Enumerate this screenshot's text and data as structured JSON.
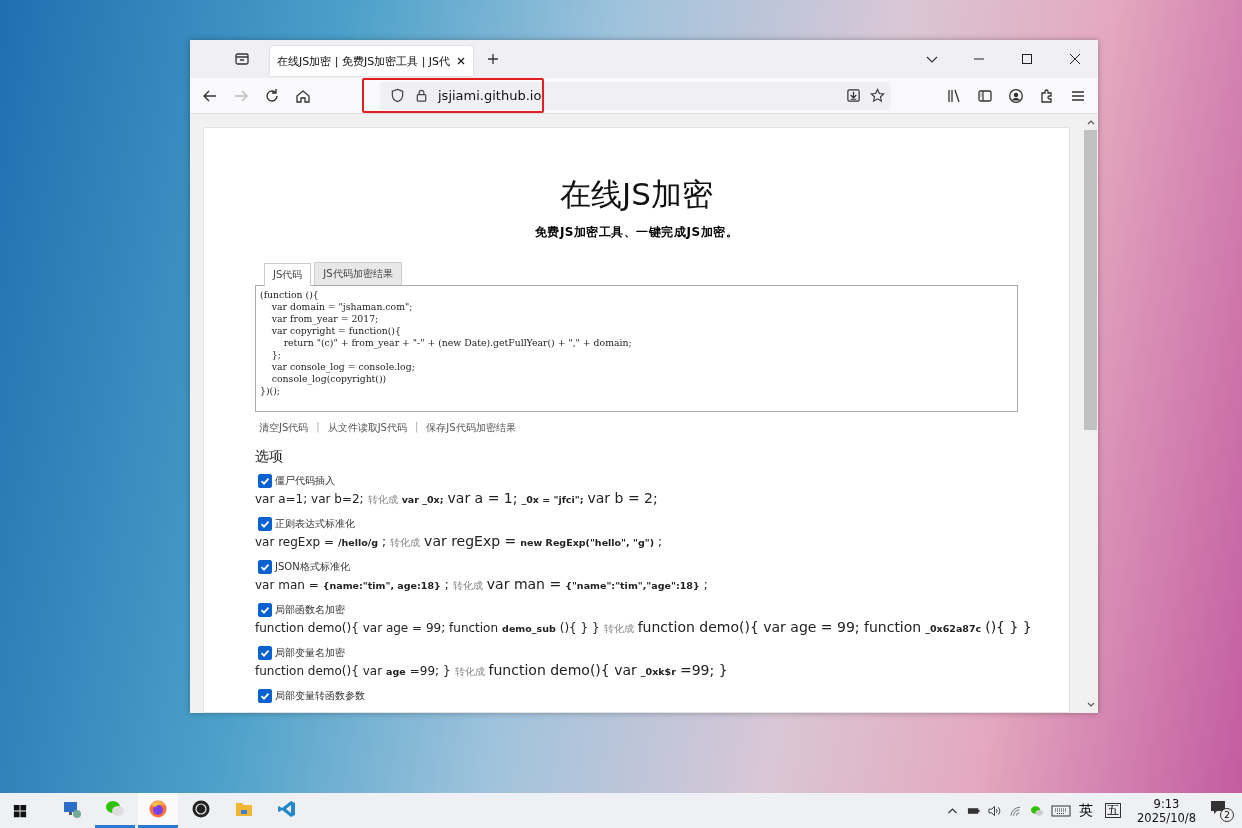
{
  "browser": {
    "tab_title": "在线JS加密 | 免费JS加密工具 | JS代",
    "address": {
      "text": "jsjiami.github.io",
      "highlighted": true
    }
  },
  "page": {
    "title": "在线JS加密",
    "subtitle": "免费JS加密工具、一键完成JS加密。",
    "tabs": [
      {
        "label": "JS代码",
        "selected": true
      },
      {
        "label": "JS代码加密结果",
        "selected": false
      }
    ],
    "code": "(function (){\n    var domain = \"jshaman.com\";\n    var from_year = 2017;\n    var copyright = function(){\n        return \"(c)\" + from_year + \"-\" + (new Date).getFullYear() + \",\" + domain;\n    };\n    var console_log = console.log;\n    console_log(copyright())\n})();",
    "links": [
      {
        "kind": "link",
        "text": "清空JS代码"
      },
      {
        "kind": "separator",
        "text": "|"
      },
      {
        "kind": "link",
        "text": "从文件读取JS代码"
      },
      {
        "kind": "separator",
        "text": "|"
      },
      {
        "kind": "link",
        "text": "保存JS代码加密结果"
      }
    ],
    "options_heading": "选项",
    "options": [
      {
        "label": "僵尸代码插入",
        "checked": true,
        "example": [
          {
            "kind": "plain",
            "text": "var a=1; var b=2;"
          },
          {
            "kind": "arrow",
            "text": "转化成"
          },
          {
            "kind": "bold",
            "text": "var _0x;"
          },
          {
            "kind": "large",
            "text": "var a = 1;"
          },
          {
            "kind": "bold",
            "text": "_0x = \"jfci\";"
          },
          {
            "kind": "large",
            "text": "var b = 2;"
          }
        ]
      },
      {
        "label": "正则表达式标准化",
        "checked": true,
        "example": [
          {
            "kind": "plain",
            "text": "var regExp ="
          },
          {
            "kind": "bold",
            "text": "/hello/g"
          },
          {
            "kind": "plain",
            "text": ";"
          },
          {
            "kind": "arrow",
            "text": "转化成"
          },
          {
            "kind": "large",
            "text": "var regExp ="
          },
          {
            "kind": "bold",
            "text": "new RegExp(\"hello\", \"g\")"
          },
          {
            "kind": "plain",
            "text": ";"
          }
        ]
      },
      {
        "label": "JSON格式标准化",
        "checked": true,
        "example": [
          {
            "kind": "plain",
            "text": "var man ="
          },
          {
            "kind": "bold",
            "text": "{name:\"tim\", age:18}"
          },
          {
            "kind": "plain",
            "text": ";"
          },
          {
            "kind": "arrow",
            "text": "转化成"
          },
          {
            "kind": "large",
            "text": "var man ="
          },
          {
            "kind": "bold",
            "text": "{\"name\":\"tim\",\"age\":18}"
          },
          {
            "kind": "plain",
            "text": ";"
          }
        ]
      },
      {
        "label": "局部函数名加密",
        "checked": true,
        "example": [
          {
            "kind": "plain",
            "text": "function demo(){ var age = 99; function"
          },
          {
            "kind": "bold",
            "text": "demo_sub"
          },
          {
            "kind": "plain",
            "text": "(){ } }"
          },
          {
            "kind": "arrow",
            "text": "转化成"
          },
          {
            "kind": "large",
            "text": "function demo(){ var age = 99; function"
          },
          {
            "kind": "bold",
            "text": "_0x62a87c"
          },
          {
            "kind": "large",
            "text": "(){ } }"
          }
        ]
      },
      {
        "label": "局部变量名加密",
        "checked": true,
        "example": [
          {
            "kind": "plain",
            "text": "function demo(){ var"
          },
          {
            "kind": "bold",
            "text": "age"
          },
          {
            "kind": "plain",
            "text": "=99; }"
          },
          {
            "kind": "arrow",
            "text": "转化成"
          },
          {
            "kind": "large",
            "text": "function demo(){ var"
          },
          {
            "kind": "bold",
            "text": "_0xk$r"
          },
          {
            "kind": "large",
            "text": "=99; }"
          }
        ]
      },
      {
        "label": "局部变量转函数参数",
        "checked": true
      }
    ]
  },
  "taskbar": {
    "apps": [
      {
        "kind": "remote",
        "active": false,
        "running": false
      },
      {
        "kind": "chat",
        "active": false,
        "running": true
      },
      {
        "kind": "firefox",
        "active": true,
        "running": true
      },
      {
        "kind": "obs",
        "active": false,
        "running": false
      },
      {
        "kind": "folder",
        "active": false,
        "running": false
      },
      {
        "kind": "code",
        "active": false,
        "running": false
      }
    ],
    "ime_lang": "英",
    "ime_mode": "五",
    "time": "9:13",
    "date": "2025/10/8",
    "notifications": "2"
  }
}
